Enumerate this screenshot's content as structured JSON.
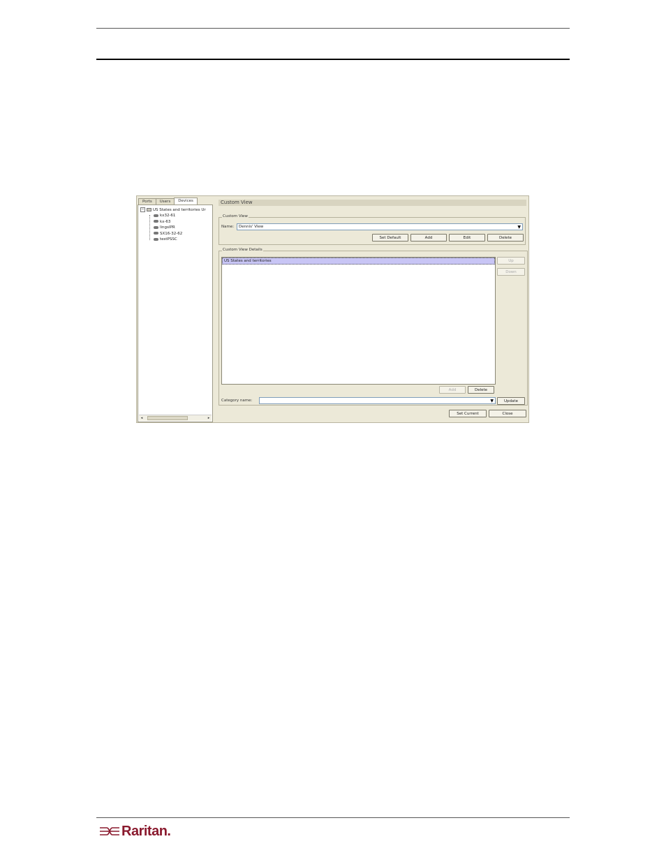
{
  "tree_panel": {
    "tabs": [
      "Ports",
      "Users",
      "Devices"
    ],
    "active_tab": "Devices",
    "root_label": "US States and territories Ur",
    "expander": "−",
    "devices": [
      "kx32-61",
      "kx-63",
      "lingsIPR",
      "SX16-32-62",
      "testPSSC"
    ]
  },
  "custom_view_panel": {
    "title": "Custom View",
    "group_label": "Custom View",
    "name_label": "Name:",
    "name_value": "Dennis' View",
    "buttons": {
      "set_default": "Set Default",
      "add": "Add",
      "edit": "Edit",
      "delete": "Delete"
    }
  },
  "details_panel": {
    "group_label": "Custom View Details",
    "list_items": [
      "US States and territories"
    ],
    "side_buttons": {
      "up": "Up",
      "down": "Down"
    },
    "add_label": "Add",
    "delete_label": "Delete",
    "category_label": "Category name:",
    "category_value": "",
    "update_label": "Update"
  },
  "footer_buttons": {
    "set_current": "Set Current",
    "close": "Close"
  },
  "logo_text": "Raritan.",
  "colors": {
    "panel_bg": "#ece9d8",
    "selection": "#c8c5f5",
    "logo": "#8a1a2e"
  }
}
